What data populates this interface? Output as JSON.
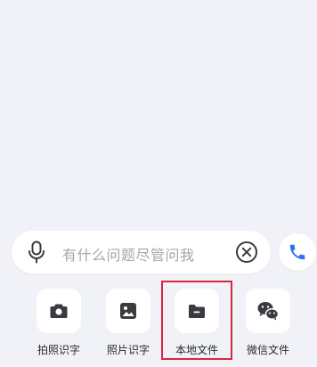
{
  "input": {
    "placeholder": "有什么问题尽管问我"
  },
  "tools": [
    {
      "label": "拍照识字",
      "icon": "camera-icon"
    },
    {
      "label": "照片识字",
      "icon": "image-icon"
    },
    {
      "label": "本地文件",
      "icon": "folder-icon"
    },
    {
      "label": "微信文件",
      "icon": "wechat-icon"
    }
  ],
  "colors": {
    "background": "#f1f2f7",
    "icon": "#3a3b3f",
    "accent_blue": "#2f6ff0",
    "highlight": "#d8283f"
  }
}
